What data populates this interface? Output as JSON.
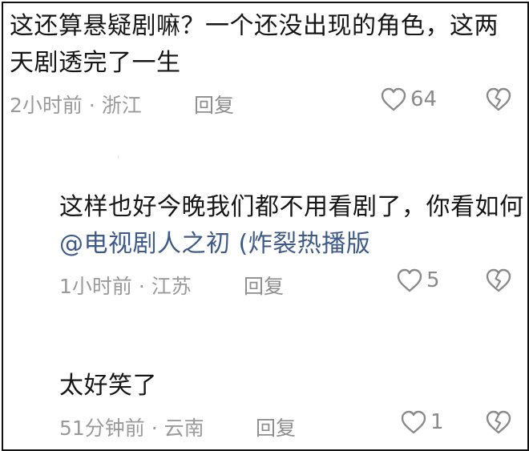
{
  "comments": [
    {
      "text": "这还算悬疑剧嘛？一个还没出现的角色，这两天剧透完了一生",
      "time": "2小时前 · 浙江",
      "reply_label": "回复",
      "likes": "64",
      "like_icon": "heart-outline-icon",
      "dislike_icon": "broken-heart-icon"
    },
    {
      "text": "这样也好今晚我们都不用看剧了，你看如何",
      "mention": "@电视剧人之初 (炸裂热播版",
      "time": "1小时前 · 江苏",
      "reply_label": "回复",
      "likes": "5",
      "like_icon": "heart-outline-icon",
      "dislike_icon": "broken-heart-icon"
    },
    {
      "text": "太好笑了",
      "time": "51分钟前 · 云南",
      "reply_label": "回复",
      "likes": "1",
      "like_icon": "heart-outline-icon",
      "dislike_icon": "broken-heart-icon"
    }
  ],
  "colors": {
    "text": "#161616",
    "meta": "#9a9a9a",
    "mention": "#3d5a8a",
    "icon": "#8a8a8a"
  }
}
